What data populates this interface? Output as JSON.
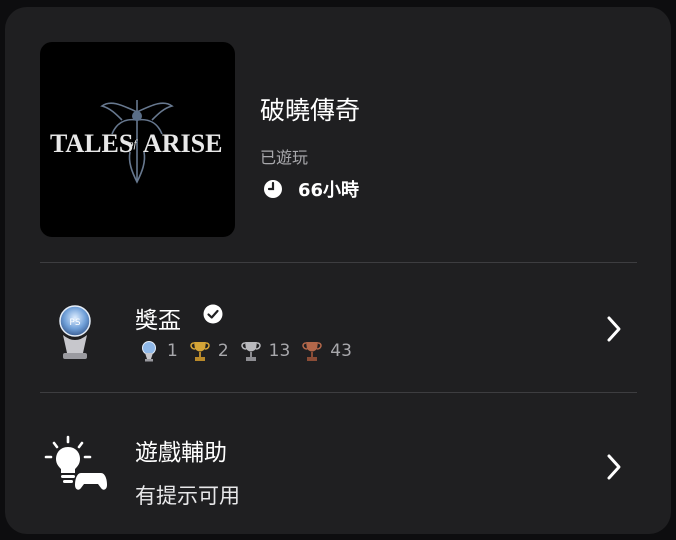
{
  "game": {
    "title": "破曉傳奇",
    "cover_text_left": "TALES",
    "cover_text_of": "of",
    "cover_text_right": "ARISE",
    "played_label": "已遊玩",
    "playtime": "66小時"
  },
  "trophies": {
    "title": "獎盃",
    "icon": "platinum-trophy-icon",
    "counts": [
      {
        "type": "platinum",
        "icon": "platinum-trophy-icon",
        "value": "1",
        "color": "#8fb8e8"
      },
      {
        "type": "gold",
        "icon": "gold-trophy-icon",
        "value": "2",
        "color": "#d4a437"
      },
      {
        "type": "silver",
        "icon": "silver-trophy-icon",
        "value": "13",
        "color": "#b9b9bd"
      },
      {
        "type": "bronze",
        "icon": "bronze-trophy-icon",
        "value": "43",
        "color": "#b2674a"
      }
    ]
  },
  "game_help": {
    "title": "遊戲輔助",
    "subtitle": "有提示可用",
    "icon": "hint-lightbulb-controller-icon"
  },
  "colors": {
    "background": "#0d0d0f",
    "card": "#1f1f21",
    "divider": "#3d3d40",
    "muted_text": "#a8a8ac"
  }
}
